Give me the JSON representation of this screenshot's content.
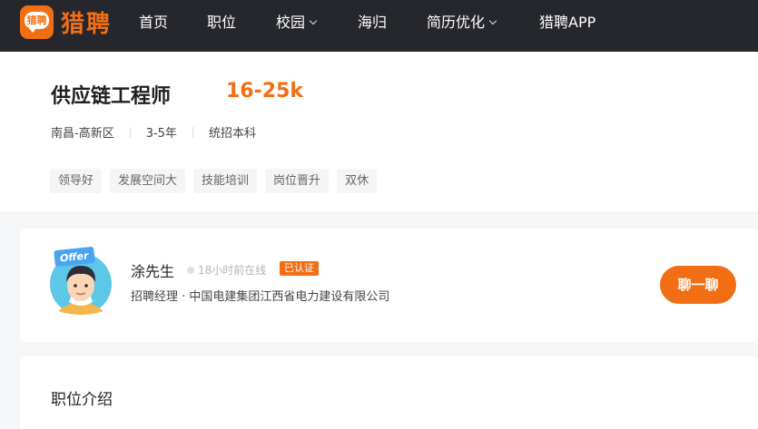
{
  "colors": {
    "brand": "#f26e15",
    "nav_bg": "#25272d",
    "page_bg": "#f5f6f8"
  },
  "logo": {
    "badge_text": "猎聘",
    "text": "猎聘"
  },
  "nav": {
    "items": [
      {
        "label": "首页"
      },
      {
        "label": "职位"
      },
      {
        "label": "校园",
        "dropdown": true
      },
      {
        "label": "海归"
      },
      {
        "label": "简历优化",
        "dropdown": true
      },
      {
        "label": "猎聘APP"
      }
    ]
  },
  "job": {
    "title": "供应链工程师",
    "salary": "16-25k",
    "location": "南昌-高新区",
    "experience": "3-5年",
    "education": "统招本科",
    "tags": [
      "领导好",
      "发展空间大",
      "技能培训",
      "岗位晋升",
      "双休"
    ]
  },
  "recruiter": {
    "avatar_badge": "Offer",
    "name": "涂先生",
    "online_status": "18小时前在线",
    "verified_label": "已认证",
    "info": "招聘经理 · 中国电建集团江西省电力建设有限公司",
    "chat_label": "聊一聊"
  },
  "section": {
    "title": "职位介绍"
  }
}
